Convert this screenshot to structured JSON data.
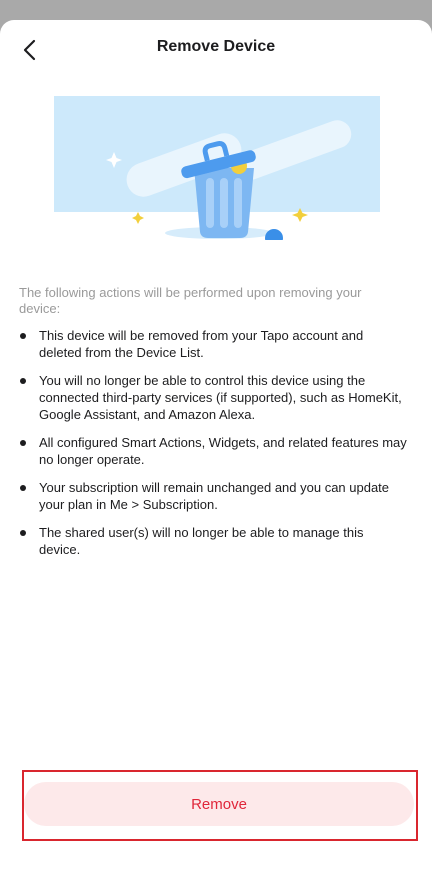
{
  "header": {
    "title": "Remove Device"
  },
  "icons": {
    "back": "chevron-left-icon",
    "illustration": "trash-can-illustration"
  },
  "intro_text": "The following actions will be performed upon removing your device:",
  "actions": [
    "This device will be removed from your Tapo account and deleted from the Device List.",
    "You will no longer be able to control this device using the connected third-party services (if supported), such as HomeKit, Google Assistant, and Amazon Alexa.",
    "All configured Smart Actions, Widgets, and related features may no longer operate.",
    "Your subscription will remain unchanged and you can update your plan in Me > Subscription.",
    "The shared user(s) will no longer be able to manage this device."
  ],
  "footer": {
    "remove_label": "Remove"
  },
  "colors": {
    "accent_red": "#e0263a",
    "button_bg": "#fde9ea",
    "illustration_bg": "#cde9fb",
    "trash_blue": "#4d9bee",
    "highlight_frame": "#d9262e"
  }
}
